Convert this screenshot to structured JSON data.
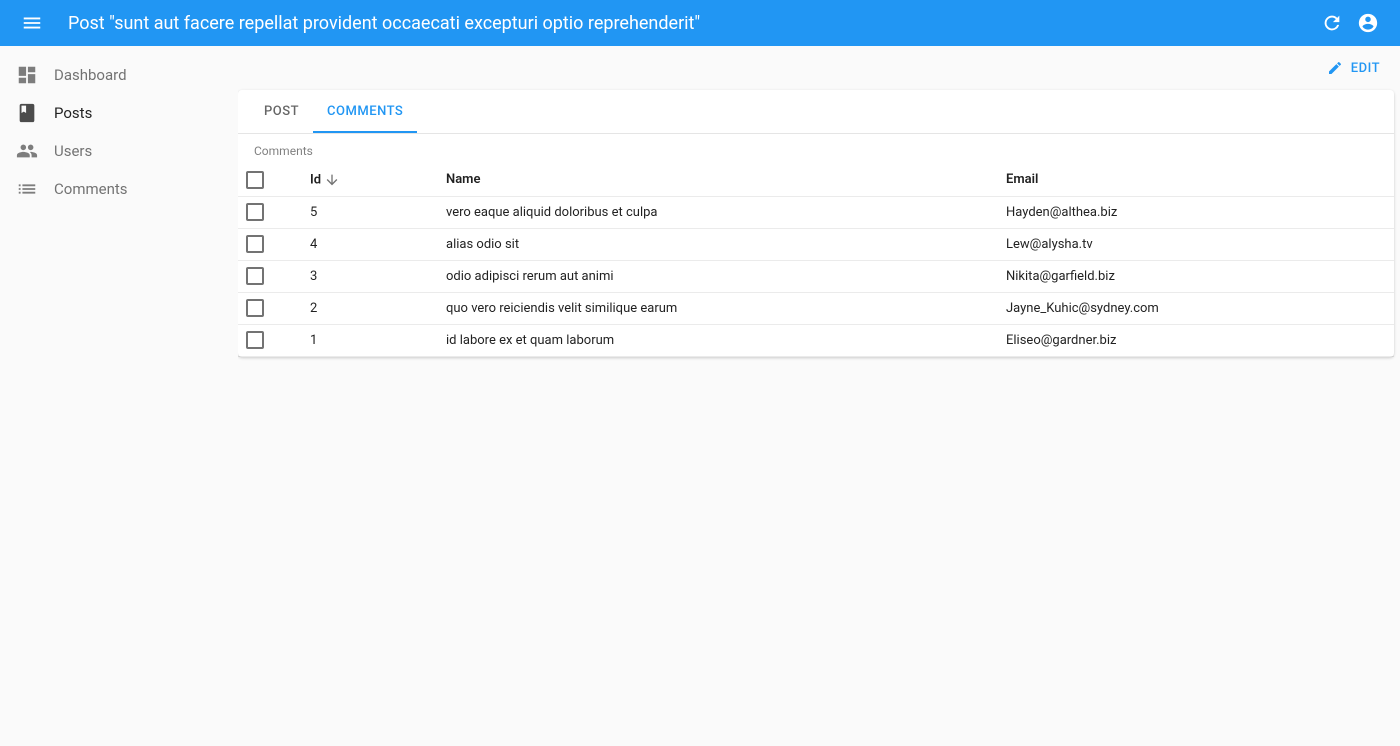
{
  "header": {
    "title": "Post \"sunt aut facere repellat provident occaecati excepturi optio reprehenderit\""
  },
  "sidebar": {
    "items": [
      {
        "label": "Dashboard"
      },
      {
        "label": "Posts"
      },
      {
        "label": "Users"
      },
      {
        "label": "Comments"
      }
    ]
  },
  "actions": {
    "edit_label": "EDIT"
  },
  "tabs": {
    "post": "POST",
    "comments": "COMMENTS"
  },
  "table": {
    "section_label": "Comments",
    "headers": {
      "id": "Id",
      "name": "Name",
      "email": "Email"
    },
    "rows": [
      {
        "id": "5",
        "name": "vero eaque aliquid doloribus et culpa",
        "email": "Hayden@althea.biz"
      },
      {
        "id": "4",
        "name": "alias odio sit",
        "email": "Lew@alysha.tv"
      },
      {
        "id": "3",
        "name": "odio adipisci rerum aut animi",
        "email": "Nikita@garfield.biz"
      },
      {
        "id": "2",
        "name": "quo vero reiciendis velit similique earum",
        "email": "Jayne_Kuhic@sydney.com"
      },
      {
        "id": "1",
        "name": "id labore ex et quam laborum",
        "email": "Eliseo@gardner.biz"
      }
    ]
  }
}
